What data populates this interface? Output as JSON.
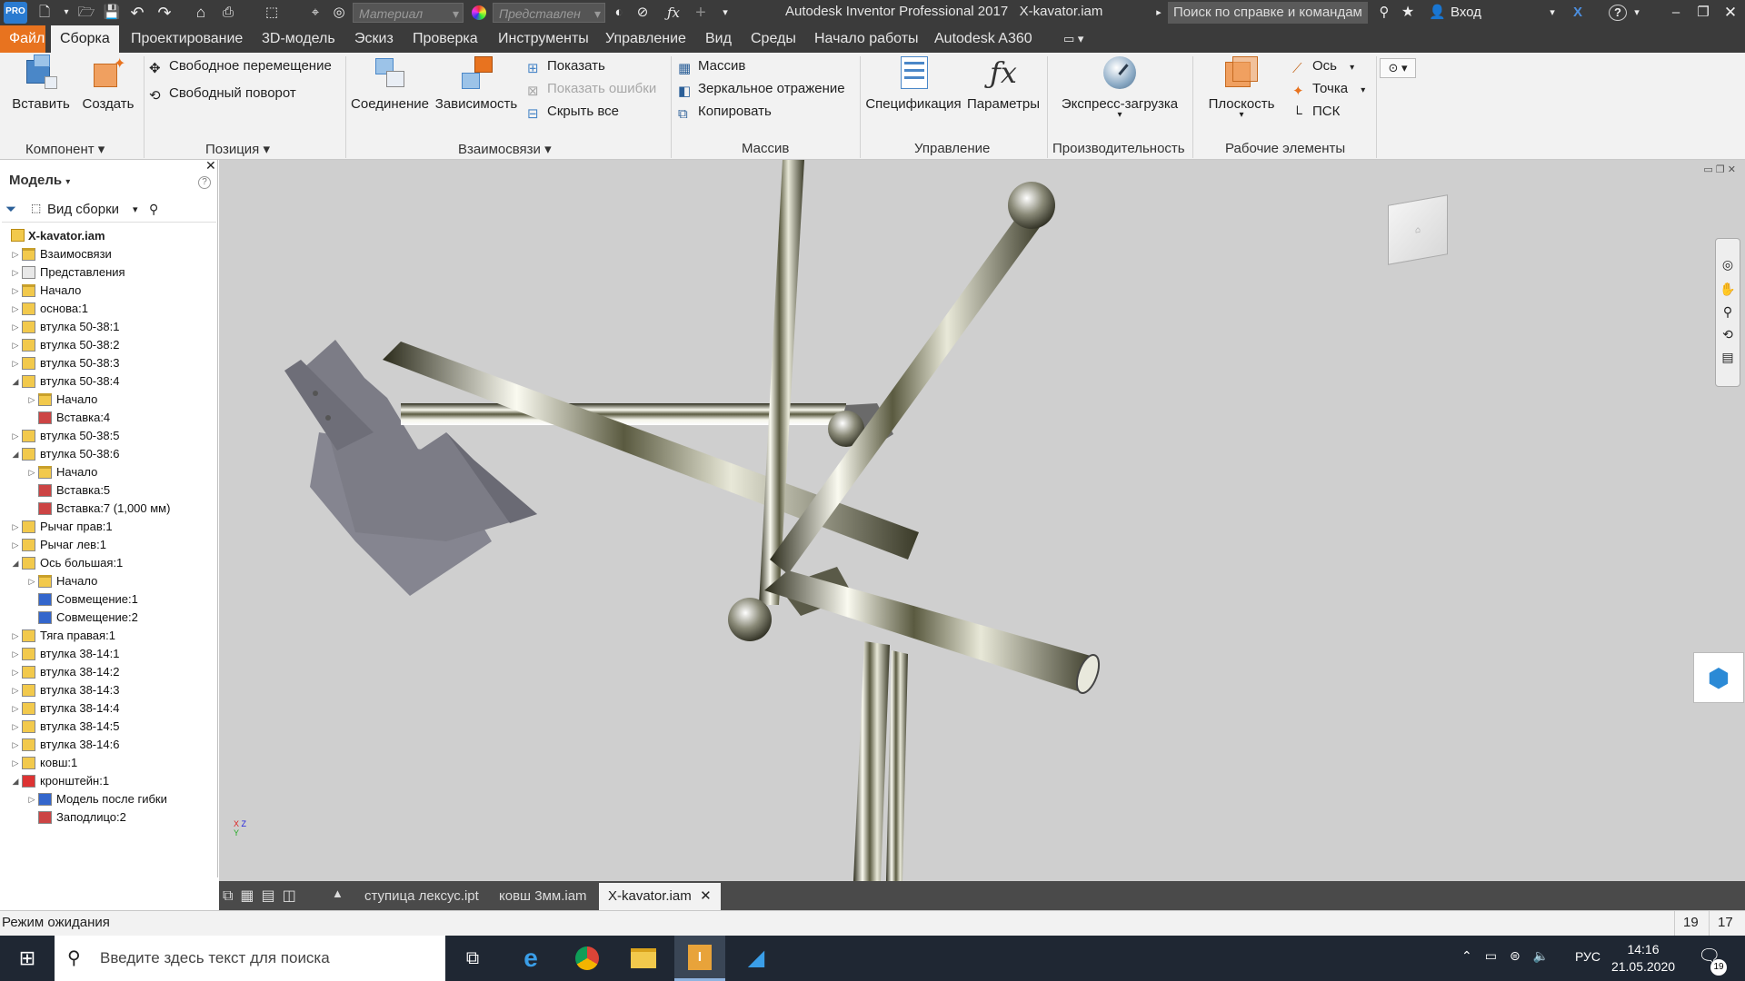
{
  "window": {
    "title": "Autodesk Inventor Professional 2017",
    "doc_title": "X-kavator.iam",
    "help_search_placeholder": "Поиск по справке и командам",
    "signin": "Вход",
    "material_dropdown": "Материал",
    "representation_dropdown": "Представлен"
  },
  "menu": {
    "items": [
      "Файл",
      "Сборка",
      "Проектирование",
      "3D-модель",
      "Эскиз",
      "Проверка",
      "Инструменты",
      "Управление",
      "Вид",
      "Среды",
      "Начало работы",
      "Autodesk A360"
    ],
    "active": "Сборка"
  },
  "ribbon": {
    "component": {
      "title": "Компонент",
      "insert": "Вставить",
      "create": "Создать"
    },
    "position": {
      "title": "Позиция",
      "free_move": "Свободное перемещение",
      "free_rotate": "Свободный поворот"
    },
    "relationships": {
      "title": "Взаимосвязи",
      "joint": "Соединение",
      "constrain": "Зависимость",
      "show": "Показать",
      "show_sick": "Показать ошибки",
      "hide_all": "Скрыть все"
    },
    "pattern": {
      "title": "Массив",
      "pattern": "Массив",
      "mirror": "Зеркальное отражение",
      "copy": "Копировать"
    },
    "manage": {
      "title": "Управление",
      "bom": "Спецификация",
      "params": "Параметры"
    },
    "productivity": {
      "title": "Производительность",
      "express": "Экспресс-загрузка"
    },
    "work_features": {
      "title": "Рабочие элементы",
      "plane": "Плоскость",
      "axis": "Ось",
      "point": "Точка",
      "ucs": "ПСК"
    }
  },
  "browser": {
    "title": "Модель",
    "view": "Вид сборки",
    "root": "X-kavator.iam",
    "items": [
      {
        "label": "Взаимосвязи",
        "level": 0,
        "icon": "folder-icon",
        "tw": "▷"
      },
      {
        "label": "Представления",
        "level": 0,
        "icon": "representations-icon",
        "tw": "▷"
      },
      {
        "label": "Начало",
        "level": 0,
        "icon": "folder-icon",
        "tw": "▷"
      },
      {
        "label": "основа:1",
        "level": 0,
        "icon": "grounded-part-icon",
        "tw": "▷"
      },
      {
        "label": "втулка 50-38:1",
        "level": 0,
        "icon": "part-icon",
        "tw": "▷"
      },
      {
        "label": "втулка 50-38:2",
        "level": 0,
        "icon": "part-icon",
        "tw": "▷"
      },
      {
        "label": "втулка 50-38:3",
        "level": 0,
        "icon": "part-icon",
        "tw": "▷"
      },
      {
        "label": "втулка 50-38:4",
        "level": 0,
        "icon": "part-icon",
        "tw": "◢"
      },
      {
        "label": "Начало",
        "level": 1,
        "icon": "folder-icon",
        "tw": "▷"
      },
      {
        "label": "Вставка:4",
        "level": 1,
        "icon": "constraint-icon",
        "tw": ""
      },
      {
        "label": "втулка 50-38:5",
        "level": 0,
        "icon": "part-icon",
        "tw": "▷"
      },
      {
        "label": "втулка 50-38:6",
        "level": 0,
        "icon": "part-icon",
        "tw": "◢"
      },
      {
        "label": "Начало",
        "level": 1,
        "icon": "folder-icon",
        "tw": "▷"
      },
      {
        "label": "Вставка:5",
        "level": 1,
        "icon": "constraint-icon",
        "tw": ""
      },
      {
        "label": "Вставка:7 (1,000 мм)",
        "level": 1,
        "icon": "constraint-icon",
        "tw": ""
      },
      {
        "label": "Рычаг прав:1",
        "level": 0,
        "icon": "part-icon",
        "tw": "▷"
      },
      {
        "label": "Рычаг лев:1",
        "level": 0,
        "icon": "part-icon",
        "tw": "▷"
      },
      {
        "label": "Ось большая:1",
        "level": 0,
        "icon": "part-icon",
        "tw": "◢"
      },
      {
        "label": "Начало",
        "level": 1,
        "icon": "folder-icon",
        "tw": "▷"
      },
      {
        "label": "Совмещение:1",
        "level": 1,
        "icon": "mate-icon",
        "tw": ""
      },
      {
        "label": "Совмещение:2",
        "level": 1,
        "icon": "mate-icon",
        "tw": ""
      },
      {
        "label": "Тяга правая:1",
        "level": 0,
        "icon": "part-icon",
        "tw": "▷"
      },
      {
        "label": "втулка 38-14:1",
        "level": 0,
        "icon": "part-icon",
        "tw": "▷"
      },
      {
        "label": "втулка 38-14:2",
        "level": 0,
        "icon": "part-icon",
        "tw": "▷"
      },
      {
        "label": "втулка 38-14:3",
        "level": 0,
        "icon": "part-icon",
        "tw": "▷"
      },
      {
        "label": "втулка 38-14:4",
        "level": 0,
        "icon": "part-icon",
        "tw": "▷"
      },
      {
        "label": "втулка 38-14:5",
        "level": 0,
        "icon": "part-icon",
        "tw": "▷"
      },
      {
        "label": "втулка 38-14:6",
        "level": 0,
        "icon": "part-icon",
        "tw": "▷"
      },
      {
        "label": "ковш:1",
        "level": 0,
        "icon": "part-icon",
        "tw": "▷"
      },
      {
        "label": "кронштейн:1",
        "level": 0,
        "icon": "sheet-metal-icon",
        "tw": "◢"
      },
      {
        "label": "Модель после гибки",
        "level": 1,
        "icon": "flat-model-icon",
        "tw": "▷"
      },
      {
        "label": "Заподлицо:2",
        "level": 1,
        "icon": "flush-icon",
        "tw": ""
      }
    ]
  },
  "doc_tabs": [
    {
      "label": "ступица лексус.ipt",
      "active": false
    },
    {
      "label": "ковш 3мм.iam",
      "active": false
    },
    {
      "label": "X-kavator.iam",
      "active": true
    }
  ],
  "status": {
    "text": "Режим ожидания",
    "count1": "19",
    "count2": "17"
  },
  "taskbar": {
    "search_placeholder": "Введите здесь текст для поиска",
    "lang": "РУС",
    "time": "14:16",
    "date": "21.05.2020",
    "notification_count": "19"
  },
  "colors": {
    "accent": "#e8731f",
    "dark": "#3b3b3b",
    "ribbon": "#f2f2f2",
    "viewport": "#cfcfcf"
  }
}
